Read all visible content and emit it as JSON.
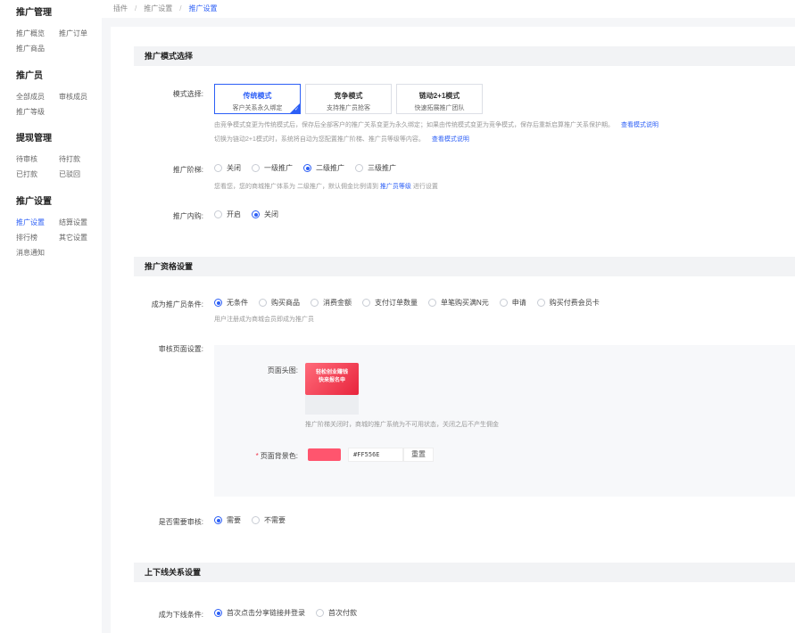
{
  "sidebar": {
    "groups": [
      {
        "title": "推广管理",
        "items": [
          "推广概览",
          "推广订单",
          "推广商品"
        ]
      },
      {
        "title": "推广员",
        "items": [
          "全部成员",
          "审核成员",
          "推广等级"
        ]
      },
      {
        "title": "提现管理",
        "items": [
          "待审核",
          "待打款",
          "已打款",
          "已驳回"
        ]
      },
      {
        "title": "推广设置",
        "items": [
          "推广设置",
          "结算设置",
          "排行榜",
          "其它设置",
          "消息通知"
        ]
      }
    ],
    "active_item": "推广设置"
  },
  "breadcrumb": {
    "items": [
      "插件",
      "推广设置",
      "推广设置"
    ]
  },
  "sections": {
    "mode": "推广模式选择",
    "qualification": "推广资格设置",
    "relation": "上下线关系设置"
  },
  "mode_select": {
    "label": "模式选择:",
    "cards": [
      {
        "title": "传统模式",
        "subtitle": "客户关系永久绑定",
        "active": true
      },
      {
        "title": "竞争模式",
        "subtitle": "支持推广员抢客",
        "active": false
      },
      {
        "title": "链动2+1模式",
        "subtitle": "快速拓展推广团队",
        "active": false
      }
    ],
    "hint1": "由竞争模式变更为传统模式后，保存后全部客户的推广关系变更为永久绑定；如果由传统模式变更为竞争模式，保存后重新启算推广关系保护期。",
    "hint2": "切换为链动2+1模式时，系统将自动为您配置推广阶梯、推广员等级等内容。",
    "link": "查看模式说明"
  },
  "level": {
    "label": "推广阶梯:",
    "options": [
      "关闭",
      "一级推广",
      "二级推广",
      "三级推广"
    ],
    "selected": 2,
    "hint_pre": "您看您，您的商城推广体系为 二级推广，默认佣金比例请到",
    "hint_link": "推广员等级",
    "hint_post": "进行设置"
  },
  "internal": {
    "label": "推广内购:",
    "options": [
      "开启",
      "关闭"
    ],
    "selected": 1
  },
  "condition": {
    "label": "成为推广员条件:",
    "options": [
      "无条件",
      "购买商品",
      "消费金额",
      "支付订单数量",
      "单笔购买满N元",
      "申请",
      "购买付费会员卡"
    ],
    "selected": 0,
    "hint": "用户注册成为商城会员即成为推广员"
  },
  "review_page": {
    "label": "审核页面设置:",
    "header_label": "页面头图:",
    "banner_text1": "轻松创业赚钱",
    "banner_text2": "快来报名申",
    "hint": "推广阶梯关闭时，商城的推广系统为不可用状态，关闭之后不产生佣金",
    "bg_label": "页面背景色:",
    "required_mark": "*",
    "color_value": "#FF556E",
    "reset": "重置"
  },
  "need_review": {
    "label": "是否需要审核:",
    "options": [
      "需要",
      "不需要"
    ],
    "selected": 0
  },
  "downline": {
    "label": "成为下线条件:",
    "options": [
      "首次点击分享链接并登录",
      "首次付款"
    ],
    "selected": 0
  },
  "colors": {
    "accent": "#2c5ff6",
    "banner": "#FF556E"
  }
}
